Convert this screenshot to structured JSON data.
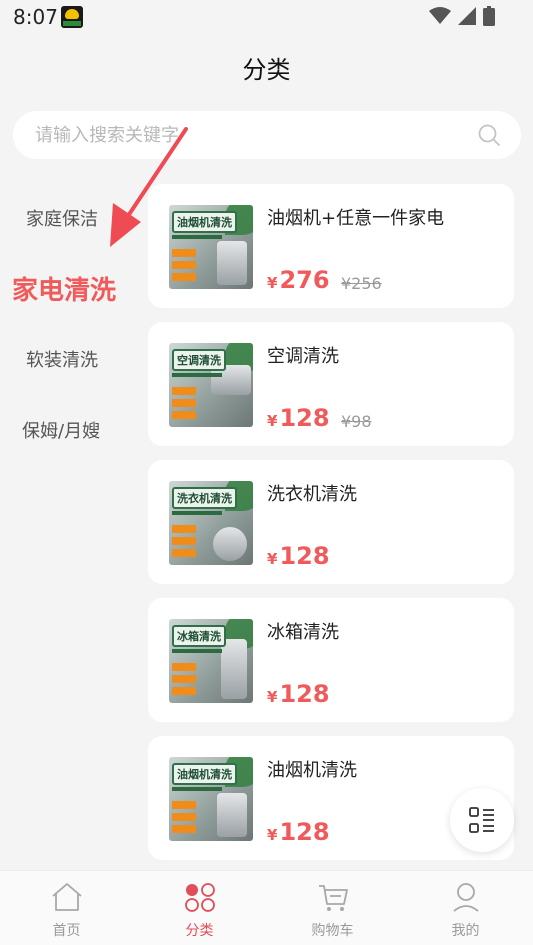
{
  "status_bar": {
    "time": "8:07"
  },
  "header": {
    "title": "分类"
  },
  "search": {
    "placeholder": "请输入搜索关键字"
  },
  "sidebar": {
    "items": [
      {
        "label": "家庭保洁",
        "active": false
      },
      {
        "label": "家电清洗",
        "active": true
      },
      {
        "label": "软装清洗",
        "active": false
      },
      {
        "label": "保姆/月嫂",
        "active": false
      }
    ]
  },
  "products": [
    {
      "name": "油烟机+任意一件家电",
      "currency": "¥",
      "price": "276",
      "old_price": "¥256",
      "thumb_title": "油烟机清洗"
    },
    {
      "name": "空调清洗",
      "currency": "¥",
      "price": "128",
      "old_price": "¥98",
      "thumb_title": "空调清洗"
    },
    {
      "name": "洗衣机清洗",
      "currency": "¥",
      "price": "128",
      "old_price": "",
      "thumb_title": "洗衣机清洗"
    },
    {
      "name": "冰箱清洗",
      "currency": "¥",
      "price": "128",
      "old_price": "",
      "thumb_title": "冰箱清洗"
    },
    {
      "name": "油烟机清洗",
      "currency": "¥",
      "price": "128",
      "old_price": "",
      "thumb_title": "油烟机清洗"
    }
  ],
  "tabbar": {
    "items": [
      {
        "label": "首页",
        "icon": "home-icon",
        "active": false
      },
      {
        "label": "分类",
        "icon": "category-icon",
        "active": true
      },
      {
        "label": "购物车",
        "icon": "cart-icon",
        "active": false
      },
      {
        "label": "我的",
        "icon": "user-icon",
        "active": false
      }
    ]
  },
  "colors": {
    "accent": "#f15a5a",
    "tab_active": "#e04e5a",
    "background": "#f4f4f4",
    "card": "#ffffff"
  }
}
